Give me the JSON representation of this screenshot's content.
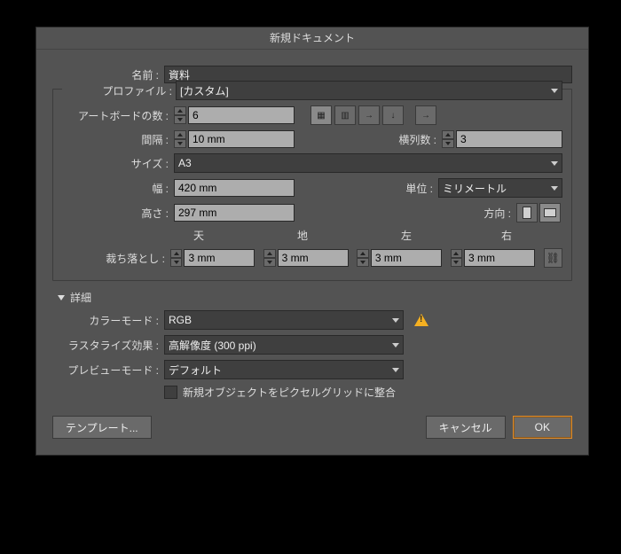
{
  "title": "新規ドキュメント",
  "name": {
    "label": "名前 :",
    "value": "資料"
  },
  "profile": {
    "label": "プロファイル :",
    "value": "[カスタム]"
  },
  "artboards": {
    "label": "アートボードの数 :",
    "value": "6"
  },
  "spacing": {
    "label": "間隔 :",
    "value": "10 mm"
  },
  "columns": {
    "label": "横列数 :",
    "value": "3"
  },
  "size": {
    "label": "サイズ :",
    "value": "A3"
  },
  "width": {
    "label": "幅 :",
    "value": "420 mm"
  },
  "units": {
    "label": "単位 :",
    "value": "ミリメートル"
  },
  "height": {
    "label": "高さ :",
    "value": "297 mm"
  },
  "orientation": {
    "label": "方向 :"
  },
  "bleed": {
    "label": "裁ち落とし :",
    "top": {
      "label": "天",
      "value": "3 mm"
    },
    "bottom": {
      "label": "地",
      "value": "3 mm"
    },
    "left": {
      "label": "左",
      "value": "3 mm"
    },
    "right": {
      "label": "右",
      "value": "3 mm"
    }
  },
  "advanced": {
    "label": "詳細"
  },
  "colorMode": {
    "label": "カラーモード :",
    "value": "RGB"
  },
  "raster": {
    "label": "ラスタライズ効果 :",
    "value": "高解像度 (300 ppi)"
  },
  "preview": {
    "label": "プレビューモード :",
    "value": "デフォルト"
  },
  "pixelGrid": {
    "label": "新規オブジェクトをピクセルグリッドに整合"
  },
  "buttons": {
    "template": "テンプレート...",
    "cancel": "キャンセル",
    "ok": "OK"
  },
  "arrangeIcons": {
    "a": "▦",
    "b": "▥",
    "c": "→",
    "d": "↓",
    "e": "→"
  }
}
